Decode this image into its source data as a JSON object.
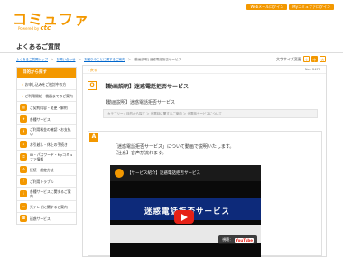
{
  "header": {
    "logo": "コミュファ",
    "logo_sub_prefix": "Powered by",
    "logo_sub_brand": "ctc",
    "buttons": [
      "Webメールログイン",
      "Myコミュファログイン"
    ]
  },
  "page_title": "よくあるご質問",
  "breadcrumb": {
    "items": [
      "よくあるご質問トップ",
      "お問い合わせ",
      "お困りのことに関するご案内"
    ],
    "current": "[動画説明] 迷惑電話拒否サービス"
  },
  "font_size": {
    "label": "文字サイズ変更",
    "small": "小",
    "medium": "中",
    "large": "大"
  },
  "sidebar": {
    "header": "目的から探す",
    "items": [
      {
        "label": "お申し込みをご検討中の方",
        "type": "plain"
      },
      {
        "label": "ご利用開始・機器までのご案内",
        "type": "plain"
      },
      {
        "label": "ご契約内容・変更・解約",
        "type": "icon"
      },
      {
        "label": "各種サービス",
        "type": "icon"
      },
      {
        "label": "ご利用料金の確認・お支払い",
        "type": "icon"
      },
      {
        "label": "お引越し・休止の手続き",
        "type": "icon"
      },
      {
        "label": "ID・パスワード・Myコミュファ情報",
        "type": "icon"
      },
      {
        "label": "接続・設定方法",
        "type": "icon"
      },
      {
        "label": "ご利用トラブル",
        "type": "icon"
      },
      {
        "label": "各種サービスに関するご案内",
        "type": "icon"
      },
      {
        "label": "光テレビに関するご案内",
        "type": "icon"
      },
      {
        "label": "迷惑サービス",
        "type": "icon"
      }
    ]
  },
  "article": {
    "back": "戻る",
    "number": "No：2477",
    "q_badge": "Q",
    "question": "【動画説明】迷惑電話拒否サービス",
    "subtitle": "【動画説明】迷惑電話拒否サービス",
    "category": "カテゴリー：目的から探す ＞ 光電話に関するご案内 ＞ 光電話サービスについて",
    "a_badge": "A",
    "answer_line1": "「迷惑電話拒否サービス」について動画で説明いたします。",
    "answer_line2": "【注意】音声が流れます。"
  },
  "video": {
    "title": "【サービス紹介】迷惑電話拒否サービス",
    "banner": "迷惑電話拒否サービス",
    "watch_label": "視聴：",
    "watch_brand": "YouTube"
  },
  "colors": {
    "accent": "#f39800",
    "video_banner": "#0d2a7a",
    "play": "#e62117"
  }
}
